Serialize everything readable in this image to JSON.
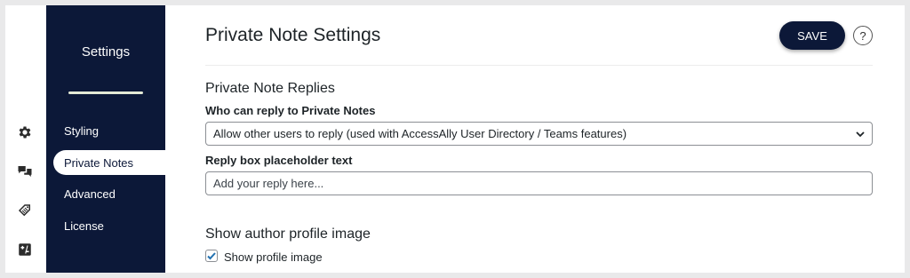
{
  "rail": {
    "icons": [
      "gear-icon",
      "chat-bubbles-icon",
      "tag-icon",
      "plus-minus-icon"
    ]
  },
  "nav": {
    "title": "Settings",
    "items": [
      {
        "label": "Styling",
        "active": false
      },
      {
        "label": "Private Notes",
        "active": true
      },
      {
        "label": "Advanced",
        "active": false
      },
      {
        "label": "License",
        "active": false
      }
    ]
  },
  "main": {
    "title": "Private Note Settings",
    "save_label": "SAVE",
    "help_label": "?",
    "replies_section": {
      "title": "Private Note Replies",
      "who_label": "Who can reply to Private Notes",
      "who_value": "Allow other users to reply (used with AccessAlly User Directory / Teams features)",
      "placeholder_label": "Reply box placeholder text",
      "placeholder_value": "Add your reply here..."
    },
    "profile_section": {
      "title": "Show author profile image",
      "checkbox_label": "Show profile image",
      "checked": true
    }
  },
  "colors": {
    "nav_bg": "#0c1838",
    "accent": "#0c1838",
    "checkbox_accent": "#2271b1"
  }
}
